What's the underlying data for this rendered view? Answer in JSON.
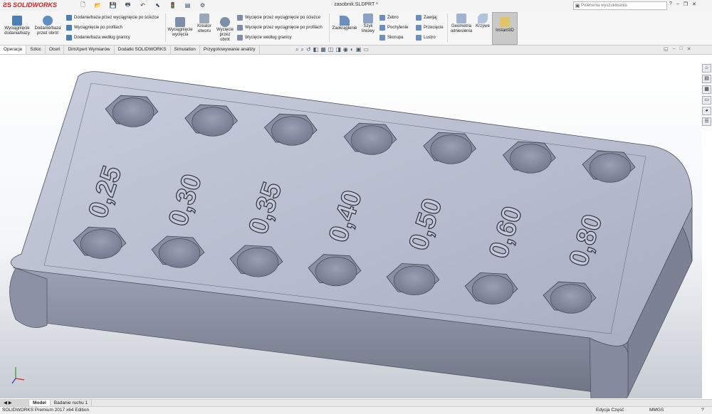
{
  "app": {
    "logo_text": "SOLIDWORKS",
    "document_title": "zasobnik.SLDPRT *"
  },
  "search": {
    "placeholder": "Polecenia wyszukiwania"
  },
  "window_controls": [
    "?",
    "–",
    "❐",
    "✕"
  ],
  "ribbon": {
    "features": [
      {
        "label": "Wyciągnięcie dodania/bazy",
        "line1": "Wyciągnięcie",
        "line2": "dodania/bazy"
      },
      {
        "label": "Dodanie/baza przez obrót",
        "line1": "Dodanie/baza",
        "line2": "przez obrót"
      }
    ],
    "sweep_group": [
      "Dodanie/baza przez wyciągnięcie po ścieżce",
      "Wyciągnięcie po profilach",
      "Dodanie/baza według granicy"
    ],
    "cut_buttons": [
      {
        "line1": "Wyciągnięcie",
        "line2": "wycięcia"
      },
      {
        "line1": "Kreator",
        "line2": "otworu"
      },
      {
        "line1": "Wycięcie",
        "line2": "przez",
        "line3": "obrót"
      }
    ],
    "cut_group": [
      "Wycięcie przez wyciągnięcie po ścieżce",
      "Wycięcie przez wyciągnięcie po profilach",
      "Wycięcie według granicy"
    ],
    "fillet": "Zaokrąglenie",
    "pattern": {
      "line1": "Szyk",
      "line2": "liniowy"
    },
    "col_a": [
      "Żebro",
      "Pochylenie",
      "Skorupa"
    ],
    "col_b": [
      "Zawijaj",
      "Przecięcie",
      "Lustro"
    ],
    "ref_geometry": {
      "line1": "Geometria",
      "line2": "odniesienia"
    },
    "curves": "Krzywe",
    "instant3d": "Instant3D"
  },
  "command_tabs": [
    "Operacje",
    "Szkic",
    "Oceń",
    "DimXpert Wymiarów",
    "Dodatki SOLIDWORKS",
    "Simulation",
    "Przygotowywanie analizy"
  ],
  "model": {
    "labels": [
      "0,25",
      "0,30",
      "0,35",
      "0,40",
      "0,50",
      "0,60",
      "0,80"
    ]
  },
  "bottom_tabs": [
    "Model",
    "Badanie ruchu 1"
  ],
  "status": {
    "product": "SOLIDWORKS Premium 2017 x64 Edition",
    "mode": "Edycja Część",
    "units": "MMGS",
    "help": "?"
  },
  "colors": {
    "part_top": "#b8bed1",
    "part_side": "#8f95a6",
    "accent": "#d2232a"
  }
}
